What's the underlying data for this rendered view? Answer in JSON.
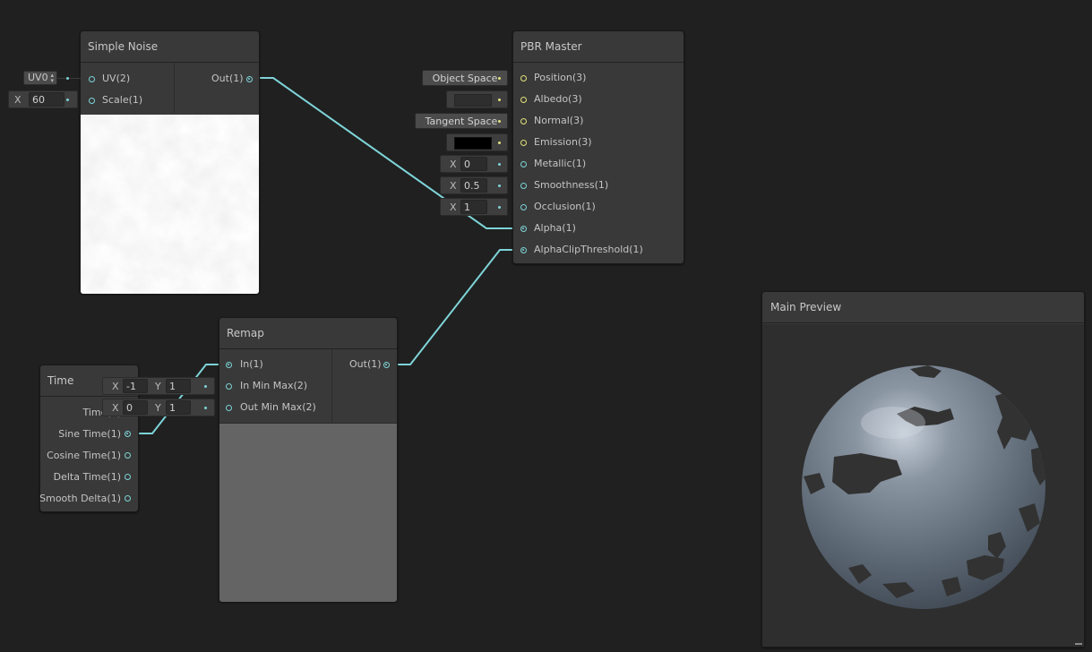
{
  "nodes": {
    "simple_noise": {
      "title": "Simple Noise",
      "inputs": [
        {
          "label": "UV(2)"
        },
        {
          "label": "Scale(1)"
        }
      ],
      "output": "Out(1)",
      "uv_dropdown": "UV0",
      "scale_axis": "X",
      "scale_value": "60"
    },
    "pbr_master": {
      "title": "PBR Master",
      "inputs": [
        {
          "label": "Position(3)",
          "control": "Object Space"
        },
        {
          "label": "Albedo(3)"
        },
        {
          "label": "Normal(3)",
          "control": "Tangent Space"
        },
        {
          "label": "Emission(3)"
        },
        {
          "label": "Metallic(1)",
          "axis": "X",
          "value": "0"
        },
        {
          "label": "Smoothness(1)",
          "axis": "X",
          "value": "0.5"
        },
        {
          "label": "Occlusion(1)",
          "axis": "X",
          "value": "1"
        },
        {
          "label": "Alpha(1)"
        },
        {
          "label": "AlphaClipThreshold(1)"
        }
      ],
      "albedo_color": "#2e2e2e",
      "emission_color": "#000000"
    },
    "remap": {
      "title": "Remap",
      "inputs": [
        {
          "label": "In(1)"
        },
        {
          "label": "In Min Max(2)",
          "x_axis": "X",
          "x": "-1",
          "y_axis": "Y",
          "y": "1"
        },
        {
          "label": "Out Min Max(2)",
          "x_axis": "X",
          "x": "0",
          "y_axis": "Y",
          "y": "1"
        }
      ],
      "output": "Out(1)"
    },
    "time": {
      "title": "Time",
      "outputs": [
        "Time(1)",
        "Sine Time(1)",
        "Cosine Time(1)",
        "Delta Time(1)",
        "Smooth Delta(1)"
      ]
    }
  },
  "main_preview": {
    "title": "Main Preview"
  },
  "colors": {
    "canvas": "#202020",
    "node_bg": "#393939",
    "edge": "#7ed4d8",
    "vector3_port": "#e4e27a",
    "vector1_port": "#7ed4d8"
  }
}
